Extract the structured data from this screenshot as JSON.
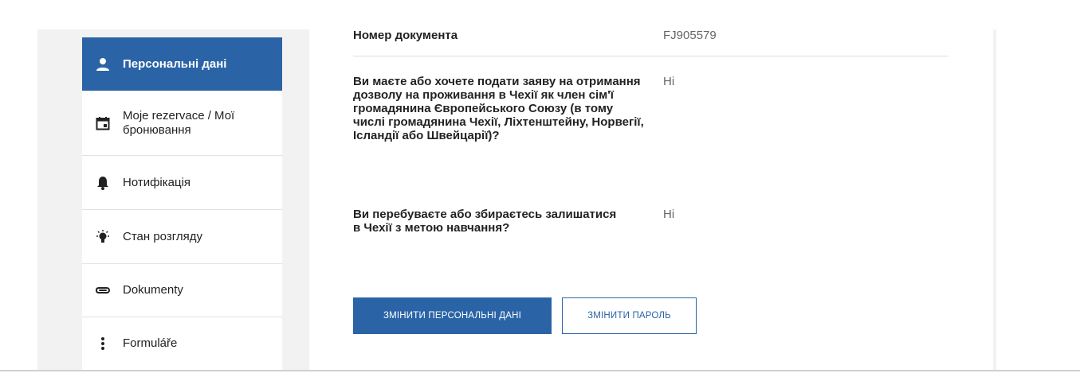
{
  "sidebar": {
    "items": [
      {
        "label": "Персональні дані",
        "icon": "person-icon",
        "active": true
      },
      {
        "label": "Moje rezervace / Мої бронювання",
        "icon": "calendar-icon",
        "active": false
      },
      {
        "label": "Нотифікація",
        "icon": "bell-icon",
        "active": false
      },
      {
        "label": "Стан розгляду",
        "icon": "lightbulb-icon",
        "active": false
      },
      {
        "label": "Dokumenty",
        "icon": "paperclip-icon",
        "active": false
      },
      {
        "label": "Formuláře",
        "icon": "more-vertical-icon",
        "active": false
      }
    ]
  },
  "details": {
    "rows": [
      {
        "label": "Номер документа",
        "value": "FJ905579"
      },
      {
        "label": "Ви маєте або хочете подати заяву на отримання дозволу на проживання в Чехії як член сім'ї громадянина Європейського Союзу (в тому числі громадянина Чехії, Ліхтенштейну, Норвегії, Ісландії або Швейцарії)?",
        "value": "Ні"
      },
      {
        "label": "Ви перебуваєте або збираєтесь залишатися в Чехії з метою навчання?",
        "value": "Ні"
      }
    ]
  },
  "actions": {
    "edit_personal_label": "ЗМІНИТИ ПЕРСОНАЛЬНІ ДАНІ",
    "change_password_label": "ЗМІНИТИ ПАРОЛЬ"
  },
  "colors": {
    "accent": "#2b64a6",
    "background": "#f2f2f2"
  }
}
